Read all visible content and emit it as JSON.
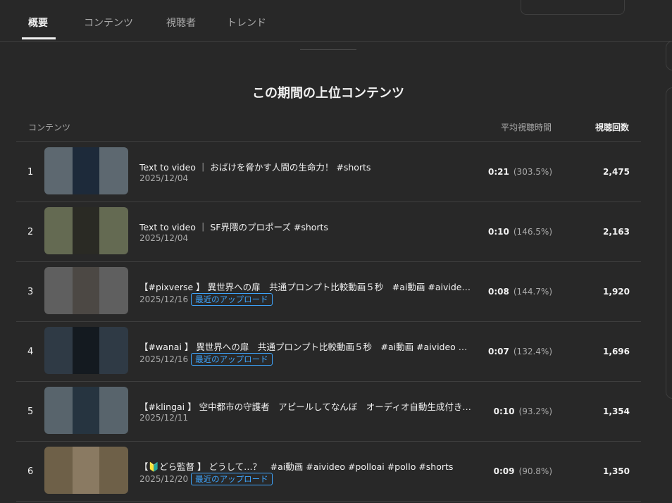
{
  "tabs": [
    "概要",
    "コンテンツ",
    "視聴者",
    "トレンド"
  ],
  "section_title": "この期間の上位コンテンツ",
  "columns": {
    "content": "コンテンツ",
    "avg_watch": "平均視聴時間",
    "views": "視聴回数"
  },
  "rows": [
    {
      "rank": "1",
      "title": "Text to video ｜ おばけを脅かす人間の生命力！ #shorts",
      "date": "2025/12/04",
      "badge": "",
      "avg_time": "0:21",
      "avg_pct": "(303.5%)",
      "views": "2,475"
    },
    {
      "rank": "2",
      "title": "Text to video ｜ SF界隈のプロポーズ #shorts",
      "date": "2025/12/04",
      "badge": "",
      "avg_time": "0:10",
      "avg_pct": "(146.5%)",
      "views": "2,163"
    },
    {
      "rank": "3",
      "title": "【#pixverse 】 異世界への扉　共通プロンプト比較動画５秒　#ai動画 #aivideo #pixverse",
      "date": "2025/12/16",
      "badge": "最近のアップロード",
      "avg_time": "0:08",
      "avg_pct": "(144.7%)",
      "views": "1,920"
    },
    {
      "rank": "4",
      "title": "【#wanai 】 異世界への扉　共通プロンプト比較動画５秒　#ai動画 #aivideo #pollo",
      "date": "2025/12/16",
      "badge": "最近のアップロード",
      "avg_time": "0:07",
      "avg_pct": "(132.4%)",
      "views": "1,696"
    },
    {
      "rank": "5",
      "title": "【#klingai 】 空中都市の守護者　アピールしてなんぼ　オーディオ自動生成付き動画",
      "date": "2025/12/11",
      "badge": "",
      "avg_time": "0:10",
      "avg_pct": "(93.2%)",
      "views": "1,354"
    },
    {
      "rank": "6",
      "title": "【🔰どら監督 】 どうして…？　#ai動画 #aivideo #polloai #pollo #shorts",
      "date": "2025/12/20",
      "badge": "最近のアップロード",
      "avg_time": "0:09",
      "avg_pct": "(90.8%)",
      "views": "1,350"
    }
  ],
  "thumb_colors": [
    {
      "bg": "#5d6870",
      "fg": "#1d2a3a"
    },
    {
      "bg": "#646a52",
      "fg": "#2a2a24"
    },
    {
      "bg": "#5f5f5f",
      "fg": "#4c4844"
    },
    {
      "bg": "#2f3a45",
      "fg": "#141a20"
    },
    {
      "bg": "#58646c",
      "fg": "#263440"
    },
    {
      "bg": "#6e6048",
      "fg": "#8a7a62"
    }
  ]
}
